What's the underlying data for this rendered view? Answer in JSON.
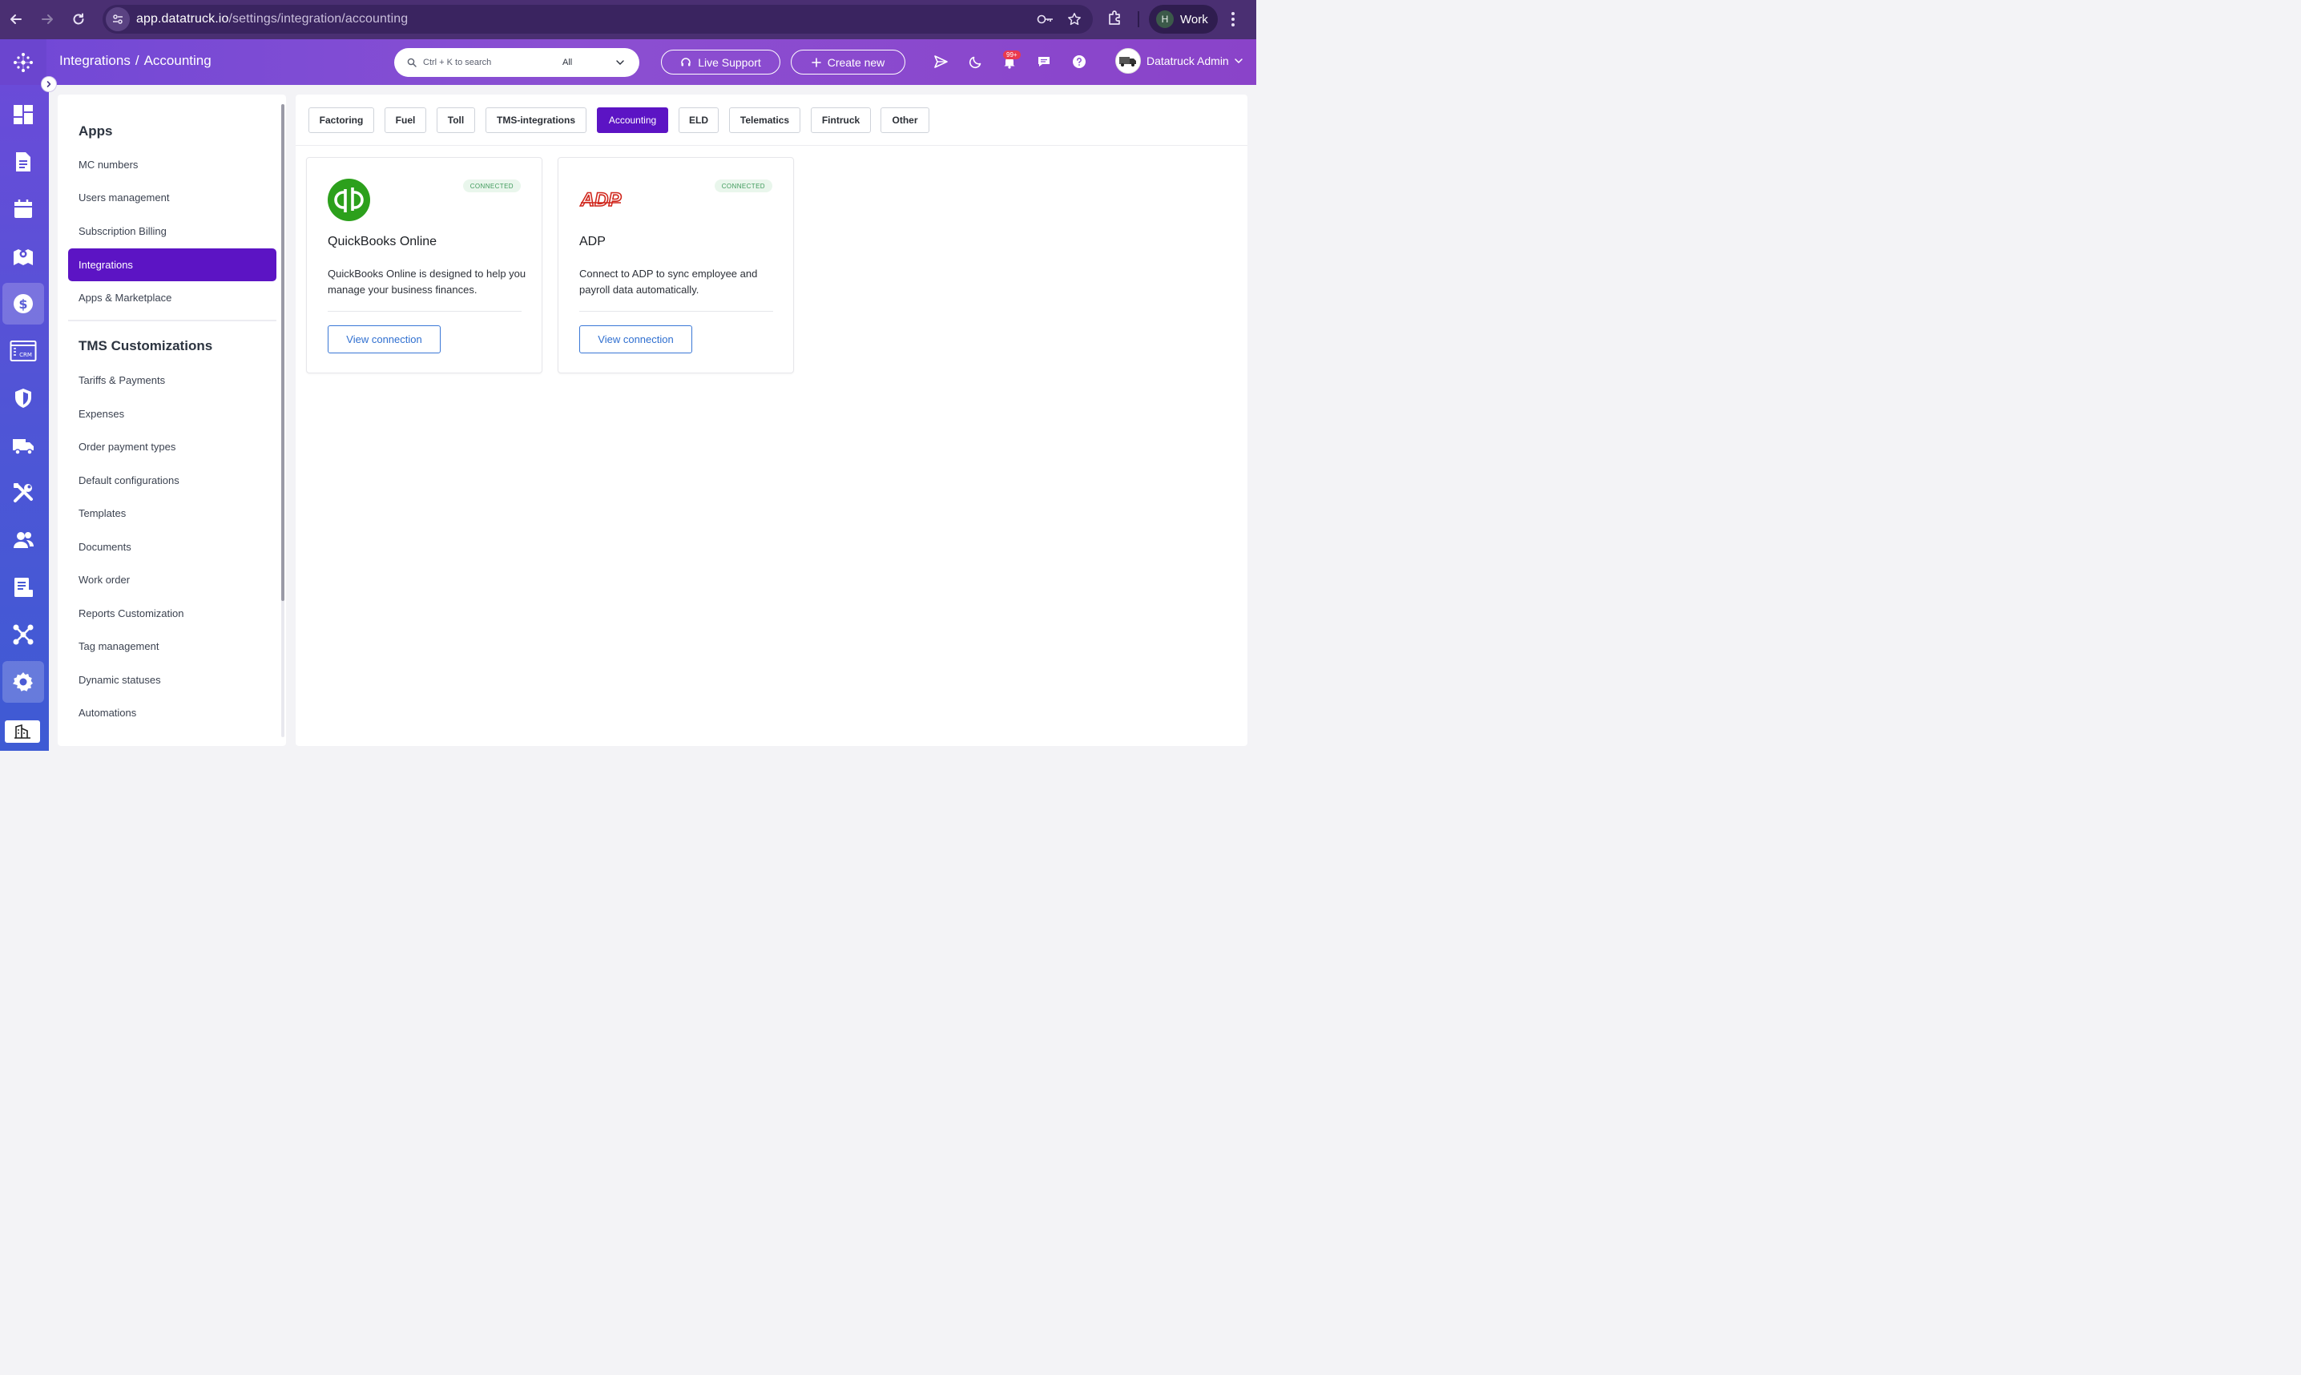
{
  "browser": {
    "url_host": "app.datatruck.io",
    "url_path": "/settings/integration/accounting",
    "profile_initial": "H",
    "profile_label": "Work"
  },
  "header": {
    "breadcrumb_parent": "Integrations",
    "breadcrumb_sep": "/",
    "breadcrumb_current": "Accounting",
    "search_placeholder": "Ctrl + K to search",
    "search_scope": "All",
    "live_support_label": "Live Support",
    "create_new_label": "Create new",
    "notification_badge": "99+",
    "user_name": "Datatruck Admin"
  },
  "rail": {
    "items": [
      "dashboard-icon",
      "document-icon",
      "calendar-icon",
      "map-icon",
      "dollar-icon",
      "crm-icon",
      "shield-icon",
      "truck-icon",
      "tools-icon",
      "users-icon",
      "report-icon",
      "network-icon",
      "settings-icon"
    ],
    "active": "settings-icon",
    "crm_text": "CRM"
  },
  "sidebar": {
    "section_apps": "Apps",
    "apps_items": [
      "MC numbers",
      "Users management",
      "Subscription Billing",
      "Integrations",
      "Apps & Marketplace"
    ],
    "active_item": "Integrations",
    "section_tms": "TMS Customizations",
    "tms_items": [
      "Tariffs & Payments",
      "Expenses",
      "Order payment types",
      "Default configurations",
      "Templates",
      "Documents",
      "Work order",
      "Reports Customization",
      "Tag management",
      "Dynamic statuses",
      "Automations"
    ]
  },
  "tabs": {
    "items": [
      "Factoring",
      "Fuel",
      "Toll",
      "TMS-integrations",
      "Accounting",
      "ELD",
      "Telematics",
      "Fintruck",
      "Other"
    ],
    "active": "Accounting"
  },
  "cards": [
    {
      "name": "QuickBooks Online",
      "status": "CONNECTED",
      "description": "QuickBooks Online is designed to help you manage your business finances.",
      "button": "View connection",
      "logo_text": "qb",
      "logo_color": "#2ca01c"
    },
    {
      "name": "ADP",
      "status": "CONNECTED",
      "description": "Connect to ADP to sync employee and payroll data automatically.",
      "button": "View connection",
      "logo_text": "ADP",
      "logo_color": "#d0271d"
    }
  ],
  "colors": {
    "accent": "#5c14c4",
    "status_green": "#3f9a5b",
    "link_blue": "#2f6fd0"
  }
}
